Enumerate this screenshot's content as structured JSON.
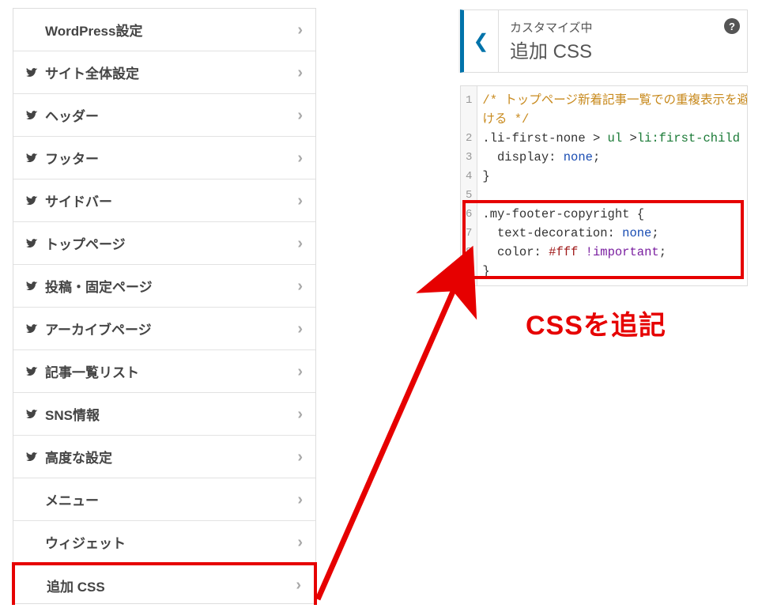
{
  "menu": {
    "items": [
      {
        "label": "WordPress設定",
        "has_icon": false
      },
      {
        "label": "サイト全体設定",
        "has_icon": true
      },
      {
        "label": "ヘッダー",
        "has_icon": true
      },
      {
        "label": "フッター",
        "has_icon": true
      },
      {
        "label": "サイドバー",
        "has_icon": true
      },
      {
        "label": "トップページ",
        "has_icon": true
      },
      {
        "label": "投稿・固定ページ",
        "has_icon": true
      },
      {
        "label": "アーカイブページ",
        "has_icon": true
      },
      {
        "label": "記事一覧リスト",
        "has_icon": true
      },
      {
        "label": "SNS情報",
        "has_icon": true
      },
      {
        "label": "高度な設定",
        "has_icon": true
      },
      {
        "label": "メニュー",
        "has_icon": false
      },
      {
        "label": "ウィジェット",
        "has_icon": false
      },
      {
        "label": "追加 CSS",
        "has_icon": false,
        "highlight": true
      }
    ]
  },
  "header": {
    "sup": "カスタマイズ中",
    "main": "追加 CSS",
    "help_glyph": "?"
  },
  "code": {
    "lines": [
      {
        "n": 1,
        "segments": [
          {
            "t": "/* トップページ新着記事一覧での重複表示を避",
            "cls": "c-comment"
          }
        ]
      },
      {
        "n": null,
        "segments": [
          {
            "t": "ける */",
            "cls": "c-comment"
          }
        ]
      },
      {
        "n": 2,
        "segments": [
          {
            "t": ".li-first-none",
            "cls": "c-sel"
          },
          {
            "t": " > ",
            "cls": "c-punct"
          },
          {
            "t": "ul",
            "cls": "c-tag"
          },
          {
            "t": " >",
            "cls": "c-punct"
          },
          {
            "t": "li",
            "cls": "c-tag"
          },
          {
            "t": ":first-child",
            "cls": "c-pseudo"
          },
          {
            "t": " {",
            "cls": "c-punct"
          }
        ]
      },
      {
        "n": 3,
        "segments": [
          {
            "t": "  display",
            "cls": "c-prop"
          },
          {
            "t": ": ",
            "cls": "c-punct"
          },
          {
            "t": "none",
            "cls": "c-val"
          },
          {
            "t": ";",
            "cls": "c-punct"
          }
        ]
      },
      {
        "n": 4,
        "segments": [
          {
            "t": "}",
            "cls": "c-punct"
          }
        ]
      },
      {
        "n": 5,
        "segments": [
          {
            "t": "",
            "cls": ""
          }
        ]
      },
      {
        "n": 6,
        "segments": [
          {
            "t": ".my-footer-copyright",
            "cls": "c-sel"
          },
          {
            "t": " {",
            "cls": "c-punct"
          }
        ]
      },
      {
        "n": 7,
        "segments": [
          {
            "t": "  text-decoration",
            "cls": "c-prop"
          },
          {
            "t": ": ",
            "cls": "c-punct"
          },
          {
            "t": "none",
            "cls": "c-val"
          },
          {
            "t": ";",
            "cls": "c-punct"
          }
        ]
      },
      {
        "n": 8,
        "segments": [
          {
            "t": "  color",
            "cls": "c-prop"
          },
          {
            "t": ": ",
            "cls": "c-punct"
          },
          {
            "t": "#fff",
            "cls": "c-hex"
          },
          {
            "t": " ",
            "cls": ""
          },
          {
            "t": "!important",
            "cls": "c-imp"
          },
          {
            "t": ";",
            "cls": "c-punct"
          }
        ]
      },
      {
        "n": 9,
        "segments": [
          {
            "t": "}",
            "cls": "c-punct"
          }
        ]
      }
    ]
  },
  "annotation": {
    "label": "CSSを追記"
  },
  "colors": {
    "highlight": "#e60000",
    "accent": "#0073aa"
  }
}
